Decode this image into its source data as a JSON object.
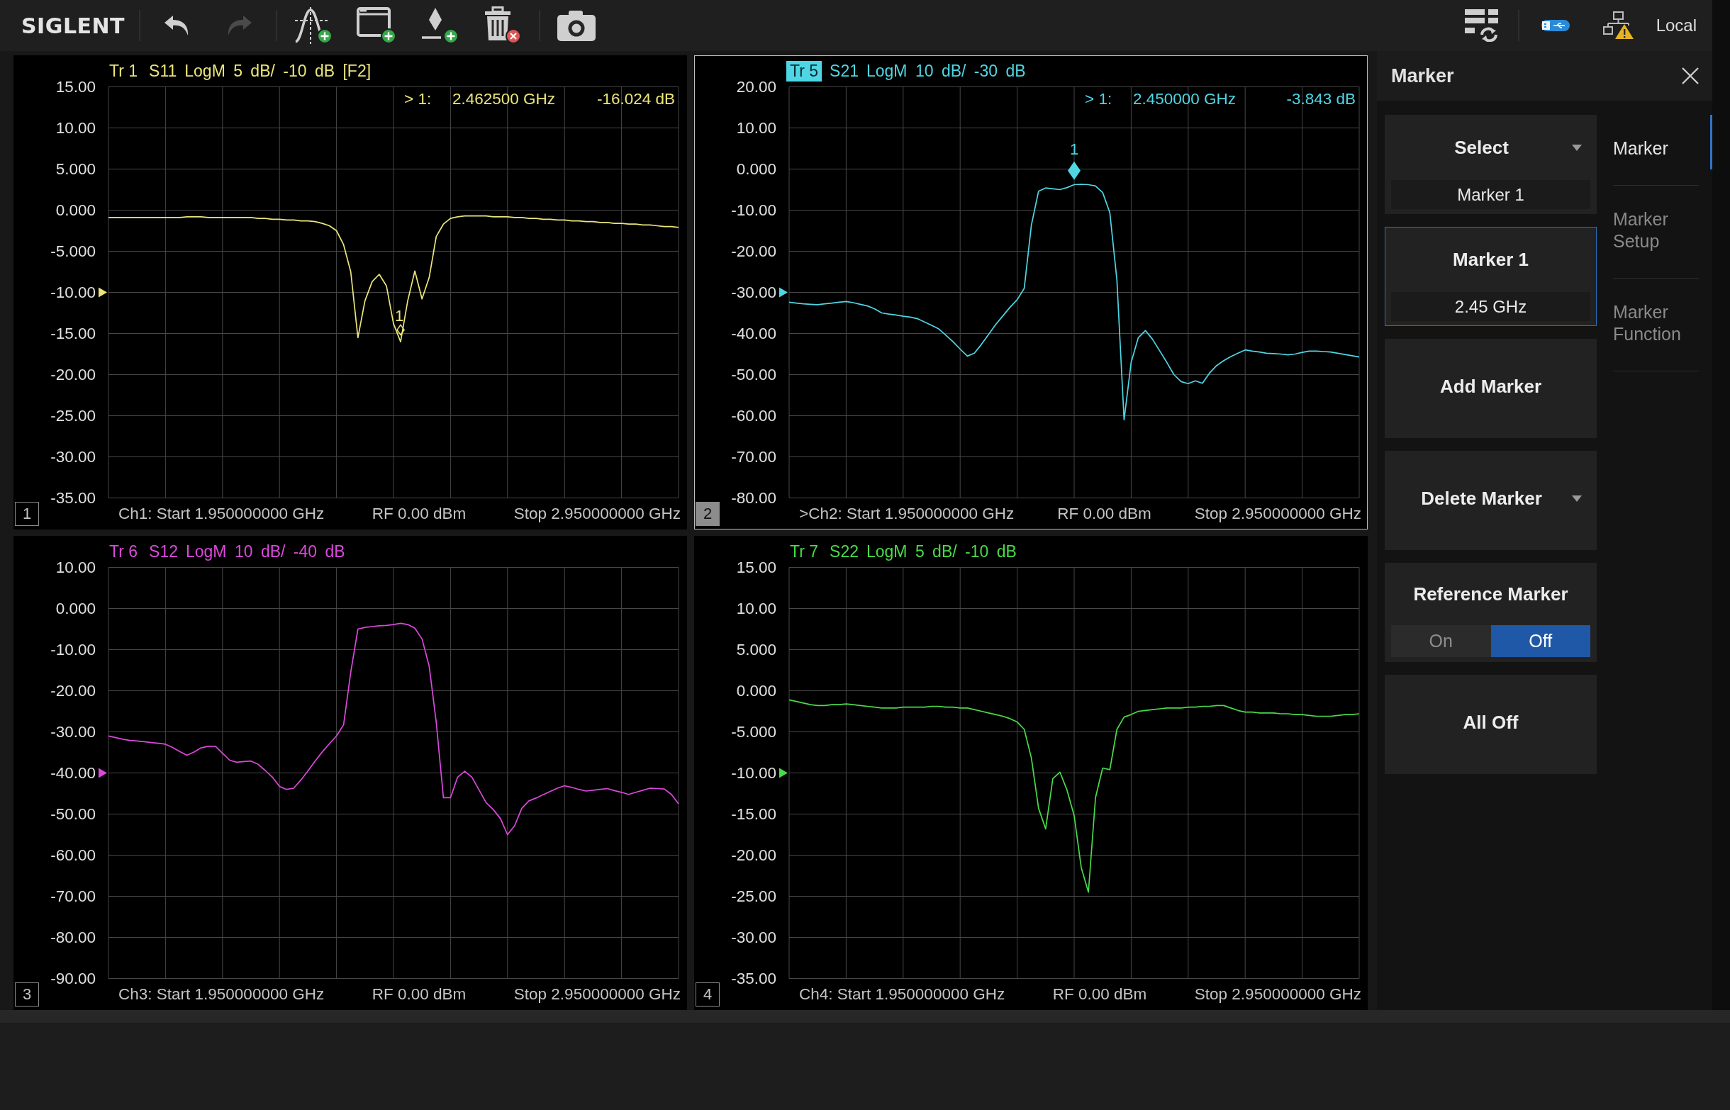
{
  "toolbar": {
    "logo": "SIGLENT",
    "button_groups": [
      [
        {
          "kind": "undo",
          "disabled": false
        },
        {
          "kind": "redo",
          "disabled": true
        }
      ],
      [
        {
          "kind": "trace",
          "disabled": false
        },
        {
          "kind": "window",
          "disabled": false
        },
        {
          "kind": "marker",
          "disabled": false
        },
        {
          "kind": "delete",
          "disabled": false
        }
      ],
      [
        {
          "kind": "camera",
          "disabled": false
        }
      ]
    ],
    "status_groups": [
      [
        {
          "kind": "layout"
        }
      ],
      [
        {
          "kind": "usb"
        },
        {
          "kind": "network"
        }
      ]
    ],
    "remote_mode": "Local"
  },
  "windows": [
    {
      "number": "1",
      "active": false,
      "trace": {
        "label": "Tr 1",
        "selected": false,
        "settings": "LogM 5 dB/ -10 dB [F2]"
      },
      "marker_readout": {
        "label": "> 1:",
        "frequency": "2.462500 GHz",
        "value": "-16.024 dB"
      },
      "footer": {
        "start": "Ch1: Start 1.950000000 GHz",
        "power": "RF 0.00 dBm",
        "stop": "Stop 2.950000000 GHz"
      },
      "chart_data": {
        "type": "line",
        "categories": [
          null,
          null,
          null,
          null,
          null,
          null,
          null,
          null,
          null,
          null,
          null,
          null,
          null,
          null,
          null,
          null,
          null,
          null,
          null,
          null,
          null,
          null,
          null,
          null,
          null,
          null,
          null,
          null,
          null,
          null,
          null,
          null,
          null,
          null,
          null,
          null,
          null,
          null,
          null,
          null,
          null,
          null,
          null,
          null,
          null,
          null,
          null,
          null,
          null,
          null,
          null,
          null,
          null,
          null,
          null,
          null,
          null,
          null,
          null,
          null,
          null,
          null,
          null,
          null,
          null,
          null,
          null,
          null,
          null,
          null,
          null,
          null,
          null,
          null,
          null,
          null,
          null,
          null,
          null,
          null,
          null
        ],
        "series": [
          {
            "name": "S11",
            "color": "#ebe57a",
            "values": [
              -0.9,
              -0.9,
              -0.9,
              -0.9,
              -0.9,
              -0.9,
              -0.9,
              -0.9,
              -0.9,
              -0.9,
              -0.9,
              -0.8,
              -0.8,
              -0.8,
              -0.9,
              -0.9,
              -0.9,
              -0.9,
              -0.9,
              -0.9,
              -0.9,
              -1.0,
              -1.0,
              -1.1,
              -1.1,
              -1.2,
              -1.2,
              -1.3,
              -1.3,
              -1.4,
              -1.6,
              -1.9,
              -2.5,
              -4.2,
              -7.5,
              -15.5,
              -11,
              -8.7,
              -7.8,
              -9.2,
              -13.8,
              -16.0,
              -11,
              -7.4,
              -10.8,
              -8.2,
              -3.2,
              -1.7,
              -1.0,
              -0.8,
              -0.7,
              -0.7,
              -0.7,
              -0.7,
              -0.8,
              -0.8,
              -0.8,
              -0.9,
              -0.9,
              -1.0,
              -1.0,
              -1.1,
              -1.1,
              -1.2,
              -1.2,
              -1.3,
              -1.3,
              -1.4,
              -1.4,
              -1.5,
              -1.5,
              -1.6,
              -1.6,
              -1.7,
              -1.7,
              -1.8,
              -1.8,
              -1.9,
              -2.0,
              -2.0,
              -2.1
            ]
          }
        ],
        "ylim": [
          -35,
          15
        ],
        "yticks": [
          {
            "value": 15,
            "label": "15.00"
          },
          {
            "value": 10,
            "label": "10.00"
          },
          {
            "value": 5,
            "label": "5.000"
          },
          {
            "value": 0,
            "label": "0.000"
          },
          {
            "value": -5,
            "label": "-5.000"
          },
          {
            "value": -10,
            "label": "-10.00"
          },
          {
            "value": -15,
            "label": "-15.00"
          },
          {
            "value": -20,
            "label": "-20.00"
          },
          {
            "value": -25,
            "label": "-25.00"
          },
          {
            "value": -30,
            "label": "-30.00"
          },
          {
            "value": -35,
            "label": "-35.00"
          }
        ],
        "grid": true,
        "annotations": [
          {
            "y": -16.024,
            "text": "1"
          }
        ]
      }
    },
    {
      "number": "2",
      "active": true,
      "trace": {
        "label": "Tr 5",
        "selected": true,
        "settings": "LogM 10 dB/ -30 dB"
      },
      "marker_readout": {
        "label": "> 1:",
        "frequency": "2.450000 GHz",
        "value": "-3.843 dB"
      },
      "footer": {
        "start": ">Ch2: Start 1.950000000 GHz",
        "power": "RF 0.00 dBm",
        "stop": "Stop 2.950000000 GHz"
      },
      "chart_data": {
        "type": "line",
        "categories": [
          null,
          null,
          null,
          null,
          null,
          null,
          null,
          null,
          null,
          null,
          null,
          null,
          null,
          null,
          null,
          null,
          null,
          null,
          null,
          null,
          null,
          null,
          null,
          null,
          null,
          null,
          null,
          null,
          null,
          null,
          null,
          null,
          null,
          null,
          null,
          null,
          null,
          null,
          null,
          null,
          null,
          null,
          null,
          null,
          null,
          null,
          null,
          null,
          null,
          null,
          null,
          null,
          null,
          null,
          null,
          null,
          null,
          null,
          null,
          null,
          null,
          null,
          null,
          null,
          null,
          null,
          null,
          null,
          null,
          null,
          null,
          null,
          null,
          null,
          null,
          null,
          null,
          null,
          null,
          null,
          null
        ],
        "series": [
          {
            "name": "S21",
            "color": "#4fd6e4",
            "values": [
              -32.4,
              -32.6,
              -32.8,
              -32.9,
              -33,
              -32.8,
              -32.6,
              -32.4,
              -32.2,
              -32.5,
              -32.9,
              -33.3,
              -34,
              -35,
              -35.3,
              -35.5,
              -35.8,
              -36,
              -36.4,
              -37.2,
              -38,
              -38.9,
              -40.4,
              -42,
              -43.8,
              -45.5,
              -44.8,
              -42.6,
              -40.2,
              -37.8,
              -35.7,
              -33.6,
              -31.8,
              -29,
              -13.6,
              -5.4,
              -4.6,
              -4.8,
              -5.0,
              -4.5,
              -3.8,
              -3.7,
              -3.8,
              -4.1,
              -5.7,
              -10.6,
              -27,
              -61,
              -47,
              -41,
              -39.3,
              -41.4,
              -44.2,
              -47,
              -50,
              -51.7,
              -52.2,
              -51.5,
              -52.1,
              -49.6,
              -47.8,
              -46.6,
              -45.6,
              -44.8,
              -44,
              -44.3,
              -44.5,
              -44.8,
              -44.9,
              -45,
              -45.2,
              -45,
              -44.6,
              -44.3,
              -44.3,
              -44.4,
              -44.5,
              -44.8,
              -45.1,
              -45.4,
              -45.7
            ]
          }
        ],
        "ylim": [
          -80,
          20
        ],
        "yticks": [
          {
            "value": 20,
            "label": "20.00"
          },
          {
            "value": 10,
            "label": "10.00"
          },
          {
            "value": 0,
            "label": "0.000"
          },
          {
            "value": -10,
            "label": "-10.00"
          },
          {
            "value": -20,
            "label": "-20.00"
          },
          {
            "value": -30,
            "label": "-30.00"
          },
          {
            "value": -40,
            "label": "-40.00"
          },
          {
            "value": -50,
            "label": "-50.00"
          },
          {
            "value": -60,
            "label": "-60.00"
          },
          {
            "value": -70,
            "label": "-70.00"
          },
          {
            "value": -80,
            "label": "-80.00"
          }
        ],
        "grid": true,
        "annotations": [
          {
            "y": -3.843,
            "text": "1"
          }
        ]
      }
    },
    {
      "number": "3",
      "active": false,
      "trace": {
        "label": "Tr 6",
        "selected": false,
        "settings": "LogM 10 dB/ -40 dB"
      },
      "footer": {
        "start": "Ch3: Start 1.950000000 GHz",
        "power": "RF 0.00 dBm",
        "stop": "Stop 2.950000000 GHz"
      },
      "chart_data": {
        "type": "line",
        "categories": [
          null,
          null,
          null,
          null,
          null,
          null,
          null,
          null,
          null,
          null,
          null,
          null,
          null,
          null,
          null,
          null,
          null,
          null,
          null,
          null,
          null,
          null,
          null,
          null,
          null,
          null,
          null,
          null,
          null,
          null,
          null,
          null,
          null,
          null,
          null,
          null,
          null,
          null,
          null,
          null,
          null,
          null,
          null,
          null,
          null,
          null,
          null,
          null,
          null,
          null,
          null,
          null,
          null,
          null,
          null,
          null,
          null,
          null,
          null,
          null,
          null,
          null,
          null,
          null,
          null,
          null,
          null,
          null,
          null,
          null,
          null,
          null,
          null,
          null,
          null,
          null,
          null,
          null,
          null,
          null,
          null
        ],
        "series": [
          {
            "name": "S12",
            "color": "#dc48dc",
            "values": [
              -31,
              -31.4,
              -31.8,
              -32.1,
              -32.2,
              -32.4,
              -32.6,
              -32.8,
              -33,
              -33.8,
              -34.8,
              -35.7,
              -34.9,
              -33.9,
              -33.5,
              -33.5,
              -35.2,
              -36.9,
              -37.4,
              -37.2,
              -37.1,
              -37.9,
              -39.4,
              -41,
              -43.3,
              -44,
              -43.7,
              -41.7,
              -39.5,
              -37.1,
              -34.9,
              -32.9,
              -31,
              -28.3,
              -15.5,
              -5,
              -4.6,
              -4.4,
              -4.2,
              -4.1,
              -3.9,
              -3.6,
              -3.9,
              -4.8,
              -7.4,
              -14,
              -27.7,
              -46,
              -46,
              -41,
              -39.6,
              -41,
              -44.1,
              -47.2,
              -48.9,
              -51.1,
              -55,
              -52.8,
              -48.6,
              -46.8,
              -46.1,
              -45.3,
              -44.5,
              -43.7,
              -43.1,
              -43.5,
              -44,
              -44.4,
              -44.2,
              -44,
              -43.8,
              -44.3,
              -44.7,
              -45.2,
              -44.7,
              -44.2,
              -43.7,
              -43.8,
              -43.9,
              -45.2,
              -47.5
            ]
          }
        ],
        "ylim": [
          -90,
          10
        ],
        "yticks": [
          {
            "value": 10,
            "label": "10.00"
          },
          {
            "value": 0,
            "label": "0.000"
          },
          {
            "value": -10,
            "label": "-10.00"
          },
          {
            "value": -20,
            "label": "-20.00"
          },
          {
            "value": -30,
            "label": "-30.00"
          },
          {
            "value": -40,
            "label": "-40.00"
          },
          {
            "value": -50,
            "label": "-50.00"
          },
          {
            "value": -60,
            "label": "-60.00"
          },
          {
            "value": -70,
            "label": "-70.00"
          },
          {
            "value": -80,
            "label": "-80.00"
          },
          {
            "value": -90,
            "label": "-90.00"
          }
        ],
        "grid": true
      }
    },
    {
      "number": "4",
      "active": false,
      "trace": {
        "label": "Tr 7",
        "selected": false,
        "settings": "LogM 5 dB/ -10 dB"
      },
      "footer": {
        "start": "Ch4: Start 1.950000000 GHz",
        "power": "RF 0.00 dBm",
        "stop": "Stop 2.950000000 GHz"
      },
      "chart_data": {
        "type": "line",
        "categories": [
          null,
          null,
          null,
          null,
          null,
          null,
          null,
          null,
          null,
          null,
          null,
          null,
          null,
          null,
          null,
          null,
          null,
          null,
          null,
          null,
          null,
          null,
          null,
          null,
          null,
          null,
          null,
          null,
          null,
          null,
          null,
          null,
          null,
          null,
          null,
          null,
          null,
          null,
          null,
          null,
          null,
          null,
          null,
          null,
          null,
          null,
          null,
          null,
          null,
          null,
          null,
          null,
          null,
          null,
          null,
          null,
          null,
          null,
          null,
          null,
          null,
          null,
          null,
          null,
          null,
          null,
          null,
          null,
          null,
          null,
          null,
          null,
          null,
          null,
          null,
          null,
          null,
          null,
          null,
          null,
          null
        ],
        "series": [
          {
            "name": "S22",
            "color": "#48dc48",
            "values": [
              -1.1,
              -1.3,
              -1.5,
              -1.7,
              -1.8,
              -1.8,
              -1.7,
              -1.7,
              -1.6,
              -1.7,
              -1.8,
              -1.9,
              -2.0,
              -2.1,
              -2.1,
              -2.1,
              -2.0,
              -2.0,
              -2.0,
              -2.0,
              -1.9,
              -1.9,
              -2.0,
              -2.0,
              -2.1,
              -2.1,
              -2.3,
              -2.5,
              -2.7,
              -2.9,
              -3.1,
              -3.4,
              -3.8,
              -4.7,
              -8.2,
              -14.3,
              -16.8,
              -10.7,
              -9.9,
              -12.1,
              -15.2,
              -21.5,
              -24.5,
              -13,
              -9.4,
              -9.6,
              -4.7,
              -3.2,
              -2.9,
              -2.5,
              -2.4,
              -2.3,
              -2.2,
              -2.1,
              -2.1,
              -2.1,
              -2.0,
              -2.0,
              -1.9,
              -1.9,
              -1.8,
              -1.8,
              -2.1,
              -2.4,
              -2.6,
              -2.6,
              -2.7,
              -2.7,
              -2.7,
              -2.8,
              -2.8,
              -2.9,
              -2.9,
              -3.0,
              -3.1,
              -3.1,
              -3.1,
              -3.0,
              -2.9,
              -2.9,
              -2.8
            ]
          }
        ],
        "ylim": [
          -35,
          15
        ],
        "yticks": [
          {
            "value": 15,
            "label": "15.00"
          },
          {
            "value": 10,
            "label": "10.00"
          },
          {
            "value": 5,
            "label": "5.000"
          },
          {
            "value": 0,
            "label": "0.000"
          },
          {
            "value": -5,
            "label": "-5.000"
          },
          {
            "value": -10,
            "label": "-10.00"
          },
          {
            "value": -15,
            "label": "-15.00"
          },
          {
            "value": -20,
            "label": "-20.00"
          },
          {
            "value": -25,
            "label": "-25.00"
          },
          {
            "value": -30,
            "label": "-30.00"
          },
          {
            "value": -35,
            "label": "-35.00"
          }
        ],
        "grid": true
      }
    }
  ],
  "panel": {
    "title": "Marker",
    "controls": [
      {
        "kind": "dropdown",
        "label": "Select",
        "value": "Marker 1",
        "selected": false
      },
      {
        "kind": "value",
        "label": "Marker 1",
        "value": "2.45 GHz",
        "selected": true
      },
      {
        "kind": "button",
        "label": "Add Marker",
        "selected": false
      },
      {
        "kind": "menu",
        "label": "Delete Marker",
        "selected": false
      },
      {
        "kind": "toggle",
        "label": "Reference Marker",
        "selected": false,
        "options": [
          {
            "label": "On",
            "selected": false
          },
          {
            "label": "Off",
            "selected": true
          }
        ]
      },
      {
        "kind": "button",
        "label": "All Off",
        "selected": false
      }
    ],
    "tabs": [
      {
        "label": "Marker",
        "selected": true
      },
      {
        "label": "Marker Setup",
        "selected": false
      },
      {
        "label": "Marker Function",
        "selected": false
      }
    ]
  }
}
